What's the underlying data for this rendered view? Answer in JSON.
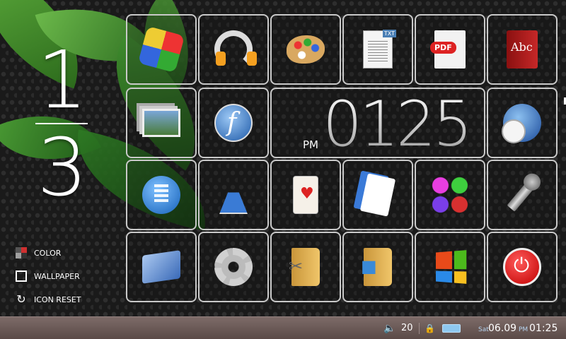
{
  "page_indicator": {
    "current": "1",
    "total": "3"
  },
  "options": [
    {
      "label": "COLOR",
      "icon": "color-palette-icon"
    },
    {
      "label": "WALLPAPER",
      "icon": "wallpaper-icon"
    },
    {
      "label": "ICON RESET",
      "icon": "reset-icon"
    }
  ],
  "apps": [
    {
      "name": "media-player",
      "icon": "media-player-icon"
    },
    {
      "name": "music",
      "icon": "headphones-icon"
    },
    {
      "name": "paint",
      "icon": "palette-icon"
    },
    {
      "name": "text-viewer",
      "icon": "txt-document-icon"
    },
    {
      "name": "pdf-viewer",
      "icon": "pdf-document-icon"
    },
    {
      "name": "dictionary",
      "icon": "dictionary-book-icon",
      "badge": "Abc"
    },
    {
      "name": "photo-viewer",
      "icon": "photos-icon"
    },
    {
      "name": "flash-player",
      "icon": "flash-icon"
    },
    {
      "name": "world-clock",
      "icon": "globe-clock-icon"
    },
    {
      "name": "calculator",
      "icon": "calculator-icon"
    },
    {
      "name": "science",
      "icon": "flask-icon"
    },
    {
      "name": "solitaire",
      "icon": "playing-card-icon"
    },
    {
      "name": "card-game",
      "icon": "playing-cards-icon"
    },
    {
      "name": "bubble-game",
      "icon": "colored-balls-icon"
    },
    {
      "name": "voice-recorder",
      "icon": "microphone-icon"
    },
    {
      "name": "desktop",
      "icon": "desktop-icon"
    },
    {
      "name": "settings",
      "icon": "gear-icon"
    },
    {
      "name": "tools-folder",
      "icon": "tools-folder-icon"
    },
    {
      "name": "programs-folder",
      "icon": "programs-folder-icon"
    },
    {
      "name": "windows",
      "icon": "windows-logo-icon"
    },
    {
      "name": "power",
      "icon": "power-icon"
    }
  ],
  "clock": {
    "ampm": "PM",
    "time": "0125"
  },
  "taskbar": {
    "volume": "20",
    "day": "Sat",
    "date": "06.09",
    "ampm": "PM",
    "time": "01:25"
  },
  "colors": {
    "tile_border": "#c9c9c9",
    "taskbar": "#6b5a57",
    "accent_text": "#b7d6f2"
  }
}
